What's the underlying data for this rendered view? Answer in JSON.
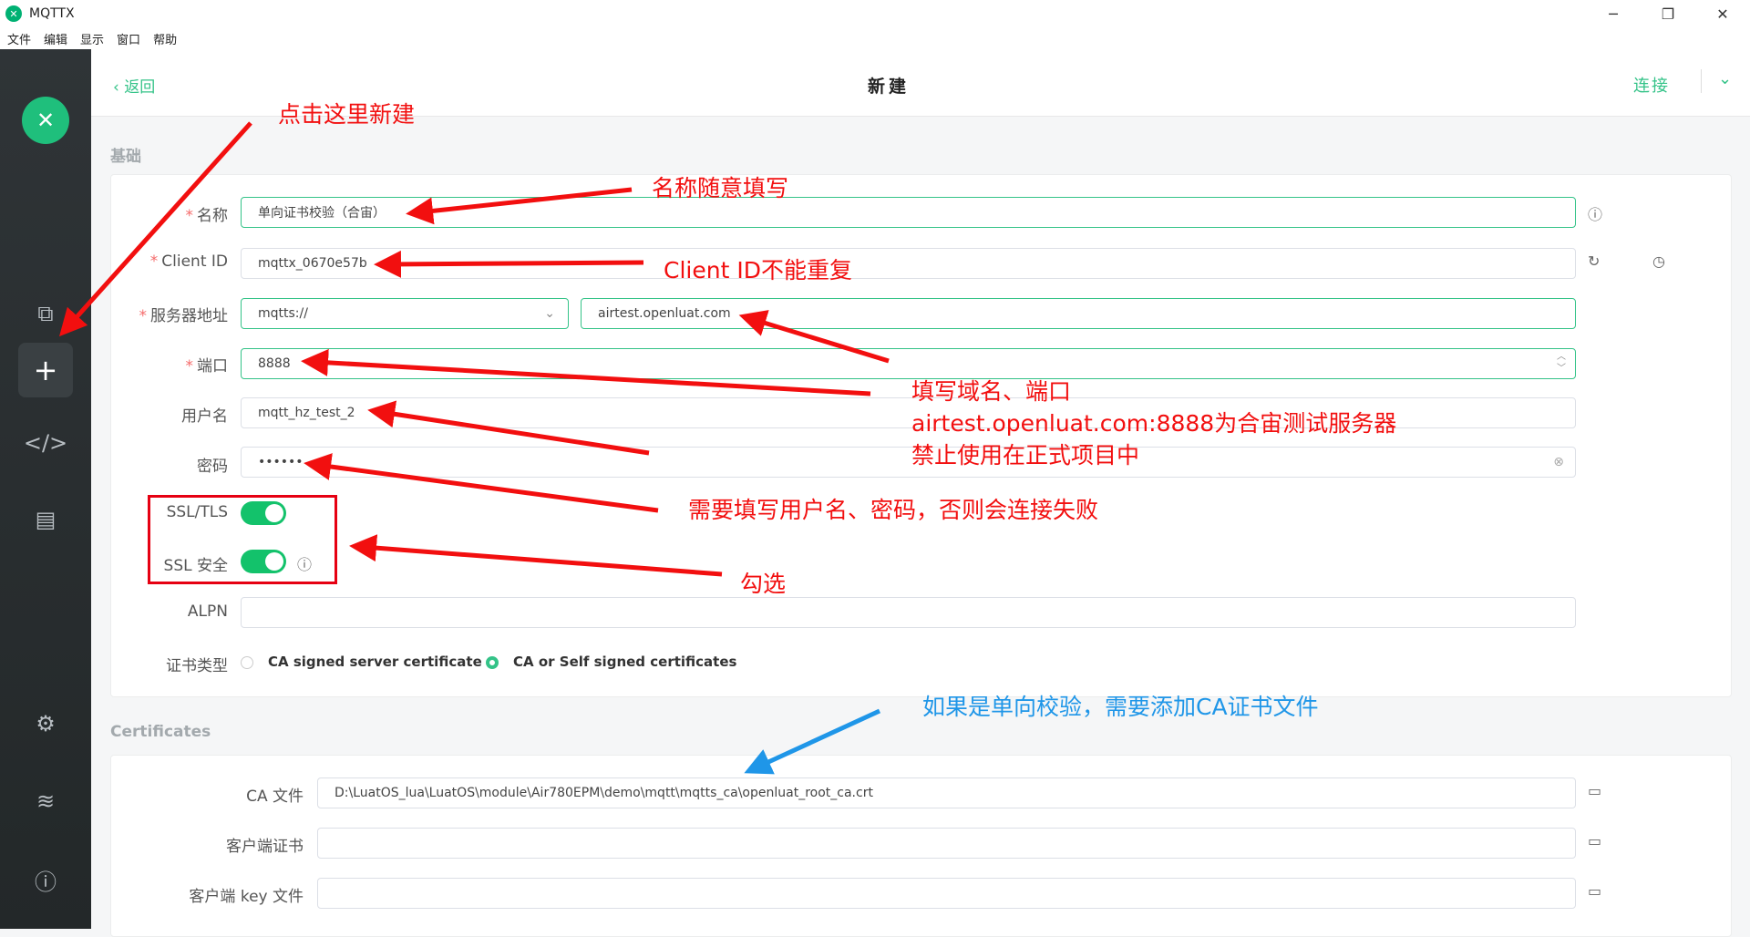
{
  "window": {
    "title": "MQTTX",
    "logo_glyph": "✕"
  },
  "menu": [
    "文件",
    "编辑",
    "显示",
    "窗口",
    "帮助"
  ],
  "topbar": {
    "back_label": "返回",
    "page_title": "新建",
    "connect_label": "连接"
  },
  "sections": {
    "basic_title": "基础",
    "certs_title": "Certificates"
  },
  "form": {
    "name_label": "名称",
    "name_value": "单向证书校验（合宙）",
    "clientid_label": "Client ID",
    "clientid_value": "mqttx_0670e57b",
    "host_label": "服务器地址",
    "protocol_value": "mqtts://",
    "host_value": "airtest.openluat.com",
    "port_label": "端口",
    "port_value": "8888",
    "username_label": "用户名",
    "username_value": "mqtt_hz_test_2",
    "password_label": "密码",
    "password_value": "••••••",
    "ssl_label": "SSL/TLS",
    "ssl_enabled": true,
    "ssl_secure_label": "SSL 安全",
    "ssl_secure_enabled": true,
    "alpn_label": "ALPN",
    "alpn_value": "",
    "cert_type_label": "证书类型",
    "cert_options": [
      "CA signed server certificate",
      "CA or Self signed certificates"
    ],
    "cert_selected": "CA or Self signed certificates"
  },
  "certificates": {
    "ca_label": "CA 文件",
    "ca_value": "D:\\LuatOS_lua\\LuatOS\\module\\Air780EPM\\demo\\mqtt\\mqtts_ca\\openluat_root_ca.crt",
    "client_cert_label": "客户端证书",
    "client_cert_value": "",
    "client_key_label": "客户端 key 文件",
    "client_key_value": ""
  },
  "annotations": {
    "new_here": "点击这里新建",
    "name_any": "名称随意填写",
    "clientid_unique": "Client ID不能重复",
    "host_port_1": "填写域名、端口",
    "host_port_2": "airtest.openluat.com:8888为合宙测试服务器",
    "host_port_3": "禁止使用在正式项目中",
    "need_credentials": "需要填写用户名、密码，否则会连接失败",
    "check_it": "勾选",
    "ca_hint": "如果是单向校验，需要添加CA证书文件"
  },
  "colors": {
    "accent": "#34c388",
    "annotation_red": "#f20f0f",
    "annotation_blue": "#1f96e8",
    "sidebar": "#2b3033"
  }
}
